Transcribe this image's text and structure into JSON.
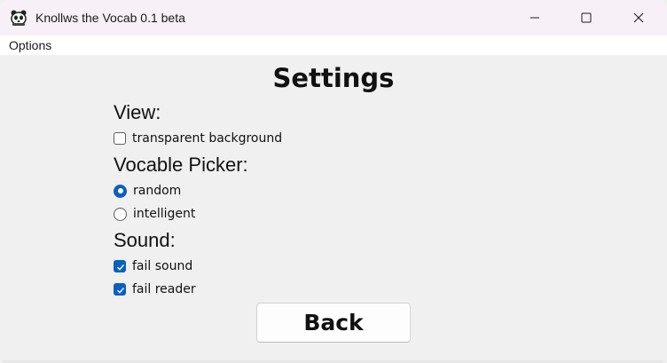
{
  "window": {
    "title": "Knollws the Vocab 0.1 beta",
    "icon": "panda-icon",
    "controls": {
      "minimize_icon": "minimize-icon",
      "maximize_icon": "maximize-icon",
      "close_icon": "close-icon"
    }
  },
  "menubar": {
    "items": [
      {
        "label": "Options"
      }
    ]
  },
  "settings": {
    "heading": "Settings",
    "view": {
      "title": "View:",
      "options": [
        {
          "label": "transparent background",
          "type": "checkbox",
          "checked": false
        }
      ]
    },
    "picker": {
      "title": "Vocable Picker:",
      "options": [
        {
          "label": "random",
          "type": "radio",
          "checked": true
        },
        {
          "label": "intelligent",
          "type": "radio",
          "checked": false
        }
      ]
    },
    "sound": {
      "title": "Sound:",
      "options": [
        {
          "label": "fail sound",
          "type": "checkbox",
          "checked": true
        },
        {
          "label": "fail reader",
          "type": "checkbox",
          "checked": true
        }
      ]
    },
    "back_label": "Back"
  },
  "colors": {
    "accent": "#0a5fc2",
    "titlebar": "#f7f0f6",
    "background": "#f0f0f0"
  }
}
